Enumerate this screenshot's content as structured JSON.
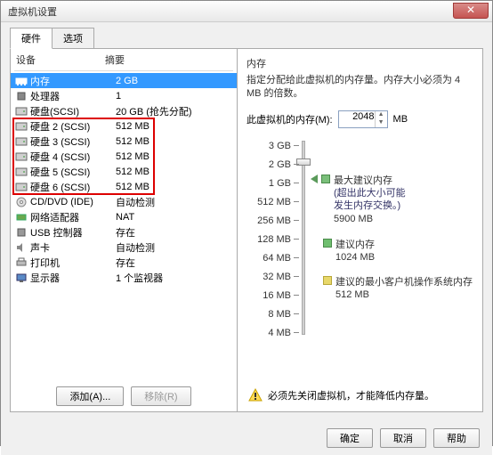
{
  "window": {
    "title": "虚拟机设置"
  },
  "tabs": [
    {
      "label": "硬件",
      "active": true
    },
    {
      "label": "选项",
      "active": false
    }
  ],
  "columns": {
    "device": "设备",
    "summary": "摘要"
  },
  "hardware": [
    {
      "icon": "memory",
      "name": "内存",
      "value": "2 GB",
      "selected": true
    },
    {
      "icon": "cpu",
      "name": "处理器",
      "value": "1"
    },
    {
      "icon": "disk",
      "name": "硬盘(SCSI)",
      "value": "20 GB (抢先分配)"
    },
    {
      "icon": "disk",
      "name": "硬盘 2 (SCSI)",
      "value": "512 MB",
      "marked": true
    },
    {
      "icon": "disk",
      "name": "硬盘 3 (SCSI)",
      "value": "512 MB",
      "marked": true
    },
    {
      "icon": "disk",
      "name": "硬盘 4 (SCSI)",
      "value": "512 MB",
      "marked": true
    },
    {
      "icon": "disk",
      "name": "硬盘 5 (SCSI)",
      "value": "512 MB",
      "marked": true
    },
    {
      "icon": "disk",
      "name": "硬盘 6 (SCSI)",
      "value": "512 MB",
      "marked": true
    },
    {
      "icon": "cd",
      "name": "CD/DVD (IDE)",
      "value": "自动检测"
    },
    {
      "icon": "net",
      "name": "网络适配器",
      "value": "NAT"
    },
    {
      "icon": "usb",
      "name": "USB 控制器",
      "value": "存在"
    },
    {
      "icon": "sound",
      "name": "声卡",
      "value": "自动检测"
    },
    {
      "icon": "printer",
      "name": "打印机",
      "value": "存在"
    },
    {
      "icon": "display",
      "name": "显示器",
      "value": "1 个监视器"
    }
  ],
  "leftButtons": {
    "add": "添加(A)...",
    "remove": "移除(R)"
  },
  "memory": {
    "heading": "内存",
    "desc": "指定分配给此虚拟机的内存量。内存大小必须为 4 MB 的倍数。",
    "fieldLabel": "此虚拟机的内存(M):",
    "value": "2048",
    "unit": "MB",
    "ticks": [
      "3 GB",
      "2 GB",
      "1 GB",
      "512 MB",
      "256 MB",
      "128 MB",
      "64 MB",
      "32 MB",
      "16 MB",
      "8 MB",
      "4 MB"
    ],
    "markers": {
      "max": {
        "title": "最大建议内存",
        "sub1": "(超出此大小可能",
        "sub2": "发生内存交换。)",
        "val": "5900 MB"
      },
      "rec": {
        "title": "建议内存",
        "val": "1024 MB"
      },
      "min": {
        "title": "建议的最小客户机操作系统内存",
        "val": "512 MB"
      }
    },
    "warning": "必须先关闭虚拟机，才能降低内存量。"
  },
  "bottom": {
    "ok": "确定",
    "cancel": "取消",
    "help": "帮助"
  }
}
